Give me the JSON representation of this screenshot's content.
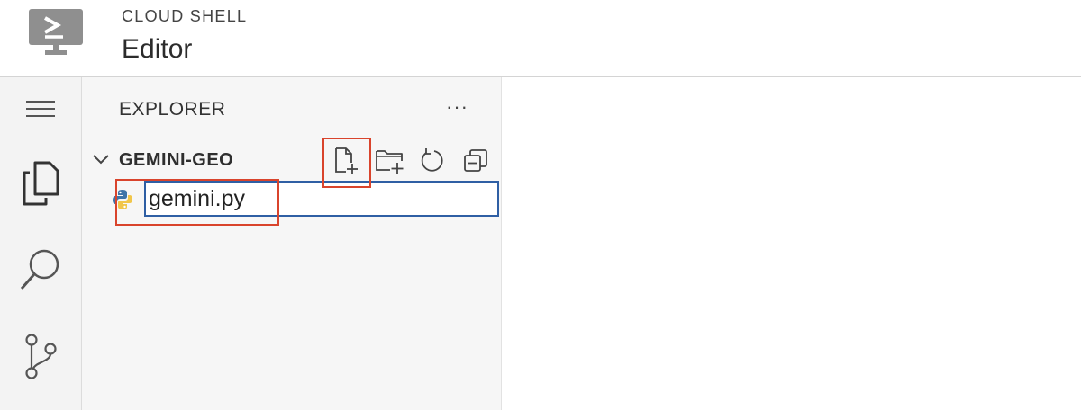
{
  "header": {
    "logo_icon": "cloud-shell-terminal-icon",
    "subtitle": "CLOUD SHELL",
    "title": "Editor"
  },
  "activity_bar": {
    "items": [
      {
        "icon": "menu-icon"
      },
      {
        "icon": "explorer-files-icon",
        "active": true
      },
      {
        "icon": "search-icon"
      },
      {
        "icon": "source-control-icon"
      }
    ]
  },
  "explorer": {
    "title": "EXPLORER",
    "more_label": "···",
    "folder": {
      "name": "GEMINI-GEO",
      "expanded": true,
      "actions": [
        {
          "icon": "new-file-icon",
          "highlighted": true
        },
        {
          "icon": "new-folder-icon"
        },
        {
          "icon": "refresh-icon"
        },
        {
          "icon": "collapse-all-icon"
        }
      ]
    },
    "new_file": {
      "icon": "python-icon",
      "value": "gemini.py"
    }
  },
  "colors": {
    "highlight": "#d9442c",
    "input_border": "#2f5fa4",
    "python_blue": "#3f74a8",
    "python_yellow": "#f1c64a"
  }
}
